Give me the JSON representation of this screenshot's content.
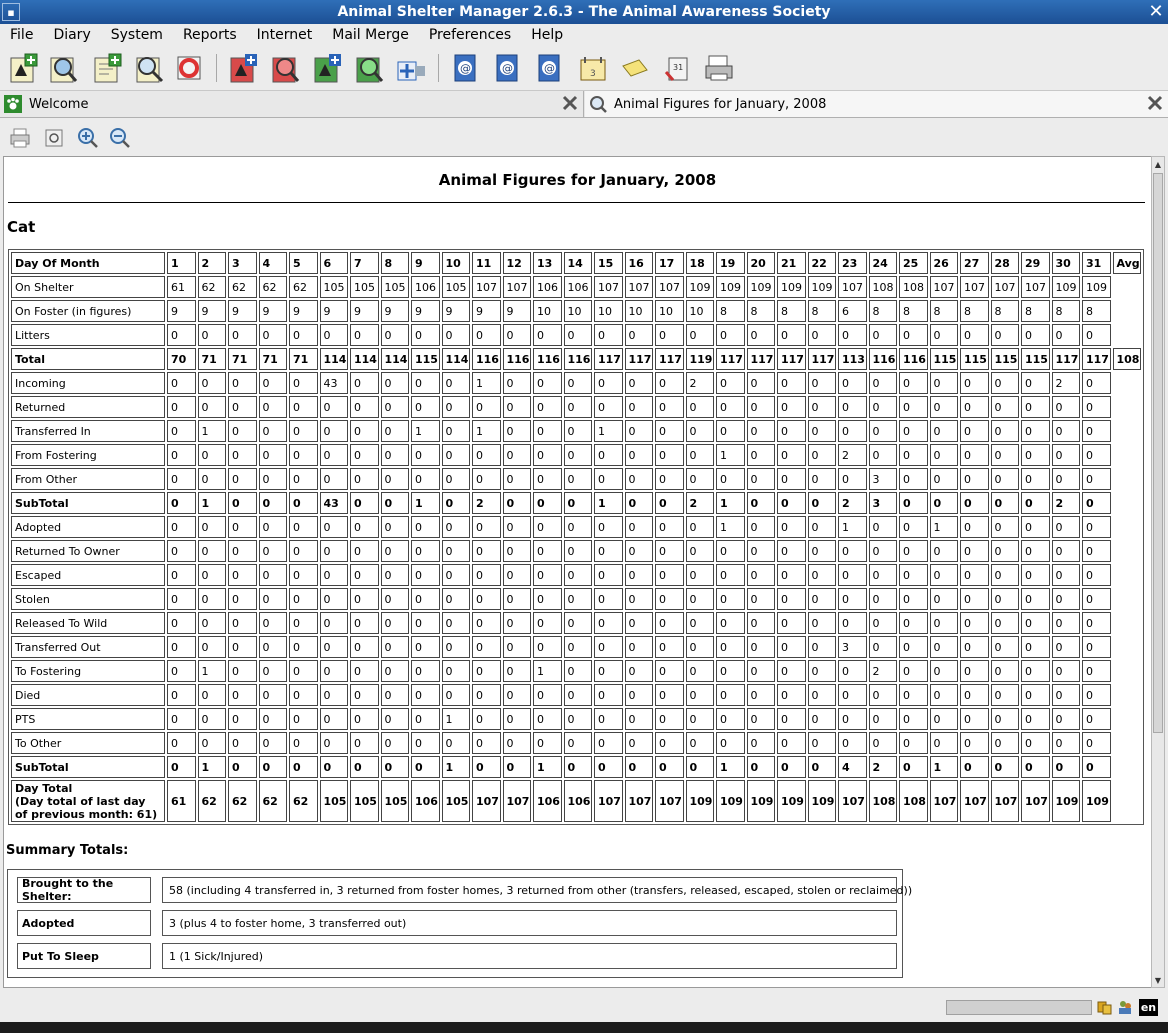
{
  "window": {
    "title": "Animal Shelter Manager 2.6.3 - The Animal Awareness Society"
  },
  "menu": [
    "File",
    "Diary",
    "System",
    "Reports",
    "Internet",
    "Mail Merge",
    "Preferences",
    "Help"
  ],
  "toolbar_icons": [
    "add-animal-icon",
    "find-animal-icon",
    "add-owner-icon",
    "find-owner-icon",
    "lost-found-icon",
    "add-lost-icon",
    "find-lost-icon",
    "add-found-icon",
    "find-found-icon",
    "waiting-list-icon",
    "mail-merge-1-icon",
    "mail-merge-2-icon",
    "mail-merge-3-icon",
    "diary-icon",
    "notes-icon",
    "calendar-icon",
    "print-tool-icon"
  ],
  "tabs": [
    {
      "label": "Welcome",
      "icon": "paw-icon"
    },
    {
      "label": "Animal Figures for January, 2008",
      "icon": "magnifier-icon"
    }
  ],
  "report": {
    "title": "Animal Figures for January, 2008",
    "species": "Cat",
    "header_label": "Day Of Month",
    "days": [
      "1",
      "2",
      "3",
      "4",
      "5",
      "6",
      "7",
      "8",
      "9",
      "10",
      "11",
      "12",
      "13",
      "14",
      "15",
      "16",
      "17",
      "18",
      "19",
      "20",
      "21",
      "22",
      "23",
      "24",
      "25",
      "26",
      "27",
      "28",
      "29",
      "30",
      "31"
    ],
    "avg_header": "Avg",
    "rows": [
      {
        "label": "On Shelter",
        "bold": false,
        "values": [
          "61",
          "62",
          "62",
          "62",
          "62",
          "105",
          "105",
          "105",
          "106",
          "105",
          "107",
          "107",
          "106",
          "106",
          "107",
          "107",
          "107",
          "109",
          "109",
          "109",
          "109",
          "109",
          "107",
          "108",
          "108",
          "107",
          "107",
          "107",
          "107",
          "109",
          "109"
        ]
      },
      {
        "label": "On Foster (in figures)",
        "bold": false,
        "values": [
          "9",
          "9",
          "9",
          "9",
          "9",
          "9",
          "9",
          "9",
          "9",
          "9",
          "9",
          "9",
          "10",
          "10",
          "10",
          "10",
          "10",
          "10",
          "8",
          "8",
          "8",
          "8",
          "6",
          "8",
          "8",
          "8",
          "8",
          "8",
          "8",
          "8",
          "8"
        ]
      },
      {
        "label": "Litters",
        "bold": false,
        "values": [
          "0",
          "0",
          "0",
          "0",
          "0",
          "0",
          "0",
          "0",
          "0",
          "0",
          "0",
          "0",
          "0",
          "0",
          "0",
          "0",
          "0",
          "0",
          "0",
          "0",
          "0",
          "0",
          "0",
          "0",
          "0",
          "0",
          "0",
          "0",
          "0",
          "0",
          "0"
        ]
      },
      {
        "label": "Total",
        "bold": true,
        "values": [
          "70",
          "71",
          "71",
          "71",
          "71",
          "114",
          "114",
          "114",
          "115",
          "114",
          "116",
          "116",
          "116",
          "116",
          "117",
          "117",
          "117",
          "119",
          "117",
          "117",
          "117",
          "117",
          "113",
          "116",
          "116",
          "115",
          "115",
          "115",
          "115",
          "117",
          "117"
        ],
        "avg": "108.58"
      },
      {
        "label": "Incoming",
        "bold": false,
        "values": [
          "0",
          "0",
          "0",
          "0",
          "0",
          "43",
          "0",
          "0",
          "0",
          "0",
          "1",
          "0",
          "0",
          "0",
          "0",
          "0",
          "0",
          "2",
          "0",
          "0",
          "0",
          "0",
          "0",
          "0",
          "0",
          "0",
          "0",
          "0",
          "0",
          "2",
          "0"
        ]
      },
      {
        "label": "Returned",
        "bold": false,
        "values": [
          "0",
          "0",
          "0",
          "0",
          "0",
          "0",
          "0",
          "0",
          "0",
          "0",
          "0",
          "0",
          "0",
          "0",
          "0",
          "0",
          "0",
          "0",
          "0",
          "0",
          "0",
          "0",
          "0",
          "0",
          "0",
          "0",
          "0",
          "0",
          "0",
          "0",
          "0"
        ]
      },
      {
        "label": "Transferred In",
        "bold": false,
        "values": [
          "0",
          "1",
          "0",
          "0",
          "0",
          "0",
          "0",
          "0",
          "1",
          "0",
          "1",
          "0",
          "0",
          "0",
          "1",
          "0",
          "0",
          "0",
          "0",
          "0",
          "0",
          "0",
          "0",
          "0",
          "0",
          "0",
          "0",
          "0",
          "0",
          "0",
          "0"
        ]
      },
      {
        "label": "From Fostering",
        "bold": false,
        "values": [
          "0",
          "0",
          "0",
          "0",
          "0",
          "0",
          "0",
          "0",
          "0",
          "0",
          "0",
          "0",
          "0",
          "0",
          "0",
          "0",
          "0",
          "0",
          "1",
          "0",
          "0",
          "0",
          "2",
          "0",
          "0",
          "0",
          "0",
          "0",
          "0",
          "0",
          "0"
        ]
      },
      {
        "label": "From Other",
        "bold": false,
        "values": [
          "0",
          "0",
          "0",
          "0",
          "0",
          "0",
          "0",
          "0",
          "0",
          "0",
          "0",
          "0",
          "0",
          "0",
          "0",
          "0",
          "0",
          "0",
          "0",
          "0",
          "0",
          "0",
          "0",
          "3",
          "0",
          "0",
          "0",
          "0",
          "0",
          "0",
          "0"
        ]
      },
      {
        "label": "SubTotal",
        "bold": true,
        "values": [
          "0",
          "1",
          "0",
          "0",
          "0",
          "43",
          "0",
          "0",
          "1",
          "0",
          "2",
          "0",
          "0",
          "0",
          "1",
          "0",
          "0",
          "2",
          "1",
          "0",
          "0",
          "0",
          "2",
          "3",
          "0",
          "0",
          "0",
          "0",
          "0",
          "2",
          "0"
        ]
      },
      {
        "label": "Adopted",
        "bold": false,
        "values": [
          "0",
          "0",
          "0",
          "0",
          "0",
          "0",
          "0",
          "0",
          "0",
          "0",
          "0",
          "0",
          "0",
          "0",
          "0",
          "0",
          "0",
          "0",
          "1",
          "0",
          "0",
          "0",
          "1",
          "0",
          "0",
          "1",
          "0",
          "0",
          "0",
          "0",
          "0"
        ]
      },
      {
        "label": "Returned To Owner",
        "bold": false,
        "values": [
          "0",
          "0",
          "0",
          "0",
          "0",
          "0",
          "0",
          "0",
          "0",
          "0",
          "0",
          "0",
          "0",
          "0",
          "0",
          "0",
          "0",
          "0",
          "0",
          "0",
          "0",
          "0",
          "0",
          "0",
          "0",
          "0",
          "0",
          "0",
          "0",
          "0",
          "0"
        ]
      },
      {
        "label": "Escaped",
        "bold": false,
        "values": [
          "0",
          "0",
          "0",
          "0",
          "0",
          "0",
          "0",
          "0",
          "0",
          "0",
          "0",
          "0",
          "0",
          "0",
          "0",
          "0",
          "0",
          "0",
          "0",
          "0",
          "0",
          "0",
          "0",
          "0",
          "0",
          "0",
          "0",
          "0",
          "0",
          "0",
          "0"
        ]
      },
      {
        "label": "Stolen",
        "bold": false,
        "values": [
          "0",
          "0",
          "0",
          "0",
          "0",
          "0",
          "0",
          "0",
          "0",
          "0",
          "0",
          "0",
          "0",
          "0",
          "0",
          "0",
          "0",
          "0",
          "0",
          "0",
          "0",
          "0",
          "0",
          "0",
          "0",
          "0",
          "0",
          "0",
          "0",
          "0",
          "0"
        ]
      },
      {
        "label": "Released To Wild",
        "bold": false,
        "values": [
          "0",
          "0",
          "0",
          "0",
          "0",
          "0",
          "0",
          "0",
          "0",
          "0",
          "0",
          "0",
          "0",
          "0",
          "0",
          "0",
          "0",
          "0",
          "0",
          "0",
          "0",
          "0",
          "0",
          "0",
          "0",
          "0",
          "0",
          "0",
          "0",
          "0",
          "0"
        ]
      },
      {
        "label": "Transferred Out",
        "bold": false,
        "values": [
          "0",
          "0",
          "0",
          "0",
          "0",
          "0",
          "0",
          "0",
          "0",
          "0",
          "0",
          "0",
          "0",
          "0",
          "0",
          "0",
          "0",
          "0",
          "0",
          "0",
          "0",
          "0",
          "3",
          "0",
          "0",
          "0",
          "0",
          "0",
          "0",
          "0",
          "0"
        ]
      },
      {
        "label": "To Fostering",
        "bold": false,
        "values": [
          "0",
          "1",
          "0",
          "0",
          "0",
          "0",
          "0",
          "0",
          "0",
          "0",
          "0",
          "0",
          "1",
          "0",
          "0",
          "0",
          "0",
          "0",
          "0",
          "0",
          "0",
          "0",
          "0",
          "2",
          "0",
          "0",
          "0",
          "0",
          "0",
          "0",
          "0"
        ]
      },
      {
        "label": "Died",
        "bold": false,
        "values": [
          "0",
          "0",
          "0",
          "0",
          "0",
          "0",
          "0",
          "0",
          "0",
          "0",
          "0",
          "0",
          "0",
          "0",
          "0",
          "0",
          "0",
          "0",
          "0",
          "0",
          "0",
          "0",
          "0",
          "0",
          "0",
          "0",
          "0",
          "0",
          "0",
          "0",
          "0"
        ]
      },
      {
        "label": "PTS",
        "bold": false,
        "values": [
          "0",
          "0",
          "0",
          "0",
          "0",
          "0",
          "0",
          "0",
          "0",
          "1",
          "0",
          "0",
          "0",
          "0",
          "0",
          "0",
          "0",
          "0",
          "0",
          "0",
          "0",
          "0",
          "0",
          "0",
          "0",
          "0",
          "0",
          "0",
          "0",
          "0",
          "0"
        ]
      },
      {
        "label": "To Other",
        "bold": false,
        "values": [
          "0",
          "0",
          "0",
          "0",
          "0",
          "0",
          "0",
          "0",
          "0",
          "0",
          "0",
          "0",
          "0",
          "0",
          "0",
          "0",
          "0",
          "0",
          "0",
          "0",
          "0",
          "0",
          "0",
          "0",
          "0",
          "0",
          "0",
          "0",
          "0",
          "0",
          "0"
        ]
      },
      {
        "label": "SubTotal",
        "bold": true,
        "values": [
          "0",
          "1",
          "0",
          "0",
          "0",
          "0",
          "0",
          "0",
          "0",
          "1",
          "0",
          "0",
          "1",
          "0",
          "0",
          "0",
          "0",
          "0",
          "1",
          "0",
          "0",
          "0",
          "4",
          "2",
          "0",
          "1",
          "0",
          "0",
          "0",
          "0",
          "0"
        ]
      }
    ],
    "day_total": {
      "label_line1": "Day Total",
      "label_line2": "(Day total of last day of previous month: 61)",
      "values": [
        "61",
        "62",
        "62",
        "62",
        "62",
        "105",
        "105",
        "105",
        "106",
        "105",
        "107",
        "107",
        "106",
        "106",
        "107",
        "107",
        "107",
        "109",
        "109",
        "109",
        "109",
        "109",
        "107",
        "108",
        "108",
        "107",
        "107",
        "107",
        "107",
        "109",
        "109"
      ]
    },
    "summary_title": "Summary Totals:",
    "summary": [
      {
        "label": "Brought to the Shelter:",
        "value": "58 (including 4 transferred in, 3 returned from foster homes, 3 returned from other (transfers, released, escaped, stolen or reclaimed))"
      },
      {
        "label": "Adopted",
        "value": "3 (plus 4 to foster home, 3 transferred out)"
      },
      {
        "label": "Put To Sleep",
        "value": "1 (1 Sick/Injured)"
      }
    ]
  },
  "statusbar": {
    "language": "en"
  }
}
